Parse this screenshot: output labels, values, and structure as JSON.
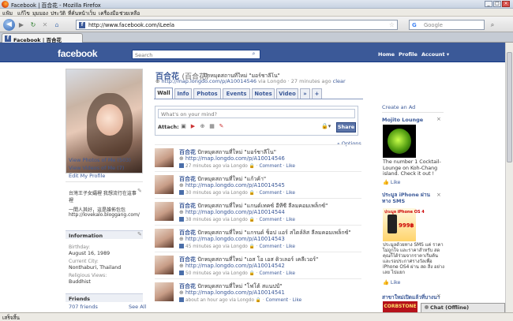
{
  "browser": {
    "title": "Facebook | 百合花 - Mozilla Firefox",
    "menu": [
      "แฟ้ม",
      "แก้ไข",
      "มุมมอง",
      "ประวัติ",
      "ที่คั่นหน้าเว็บ",
      "เครื่องมือ",
      "ช่วยเหลือ"
    ],
    "url": "http://www.facebook.com/iLeela",
    "search_placeholder": "Google",
    "tab_label": "Facebook | 百合花",
    "status": "เสร็จสิ้น"
  },
  "fb": {
    "logo": "facebook",
    "search_placeholder": "Search",
    "nav": {
      "home": "Home",
      "profile": "Profile",
      "account": "Account ▾"
    }
  },
  "left": {
    "links": [
      "View Photos of Me (503)",
      "View Videos of Me (7)",
      "Edit My Profile"
    ],
    "bio_lines": [
      "台灣王子女孀裡 我想流行在這事",
      "裡",
      "一間人其好，這是誰佈包包",
      "http://lovekalo.bloggang.com/"
    ],
    "info_title": "Information",
    "info": [
      {
        "label": "Birthday:",
        "value": "August 16, 1989"
      },
      {
        "label": "Current City:",
        "value": "Nonthaburi, Thailand"
      },
      {
        "label": "Religious Views:",
        "value": "Buddhist"
      }
    ],
    "friends_title": "Friends",
    "friends_count": "707 friends",
    "friends_seeall": "See All"
  },
  "profile": {
    "name": "百合花",
    "name_alt": "(百合花)",
    "status_text": "ปักหมุดสถานที่ใหม่ \"มอร์ชาลีโน\"",
    "url_text": "http://map.longdo.com/p/A10014546",
    "url_meta": "via Longdo · 27 minutes ago",
    "clear": "clear",
    "tabs": [
      "Wall",
      "Info",
      "Photos",
      "Events",
      "Notes",
      "Video",
      "»",
      "+"
    ]
  },
  "composer": {
    "placeholder": "What's on your mind?",
    "attach_label": "Attach:",
    "share": "Share",
    "options": "Options"
  },
  "posts": [
    {
      "name": "百合花",
      "text": "ปักหมุดสถานที่ใหม่ \"มอร์ชาลีโน\"",
      "link": "http://map.longdo.com/p/A10014546",
      "time": "27 minutes ago via Longdo",
      "actions": "Comment · Like"
    },
    {
      "name": "百合花",
      "text": "ปักหมุดสถานที่ใหม่ \"แก้วค้า\"",
      "link": "http://map.longdo.com/p/A10014545",
      "time": "30 minutes ago via Longdo",
      "actions": "Comment · Like"
    },
    {
      "name": "百合花",
      "text": "ปักหมุดสถานที่ใหม่ \"แกนด์เทคซ์ อีทีซี ลีลมคอมเพล็กซ์\"",
      "link": "http://map.longdo.com/p/A10014544",
      "time": "38 minutes ago via Longdo",
      "actions": "Comment · Like"
    },
    {
      "name": "百合花",
      "text": "ปักหมุดสถานที่ใหม่ \"แกรนด์ ช็อป แอร์ สไตล์ลิส ลีลมคอมเพล็กซ์\"",
      "link": "http://map.longdo.com/p/A10014543",
      "time": "45 minutes ago via Longdo",
      "actions": "Comment · Like"
    },
    {
      "name": "百合花",
      "text": "ปักหมุดสถานที่ใหม่ \"เอส โอ เอส ดิวเลอร์ เคลีเวอร์\"",
      "link": "http://map.longdo.com/p/A10014542",
      "time": "50 minutes ago via Longdo",
      "actions": "Comment · Like"
    },
    {
      "name": "百合花",
      "text": "ปักหมุดสถานที่ใหม่ \"โฟโต้ สแนปป์\"",
      "link": "http://map.longdo.com/p/A10014541",
      "time": "about an hour ago via Longdo",
      "actions": "Comment · Like"
    }
  ],
  "right": {
    "create_ad": "Create an Ad",
    "ads": [
      {
        "title": "Mojito Lounge",
        "text": "The number 1 Cocktail-Lounge on Koh-Chang island. Check it out !",
        "like": "Like"
      },
      {
        "title": "ประมูล iPhone ผ่านทาง SMS",
        "img_caption": "ประมูล iPhone OS 4",
        "img_price": "999฿",
        "text": "ประมูลด้วยทาง SMS แค่ ราคาไม่ถูกใจ และราคาสำหรับ สด คุณก็ได้ร่วมจากราคาเริ่มต้น และรอประกาศรางวัลเพื่อ iPhone OS4 ผ่าน สด สิ่ง อย่างเลย ไปแยก",
        "like": "Like"
      },
      {
        "title": "สาขาใหม่เปิดแล้วที่บางนา",
        "img_caption": "CORBSTONE"
      }
    ],
    "chat": "Chat (Offline)"
  },
  "colors": {
    "fb_blue": "#3b5998",
    "fb_dark": "#133783"
  }
}
